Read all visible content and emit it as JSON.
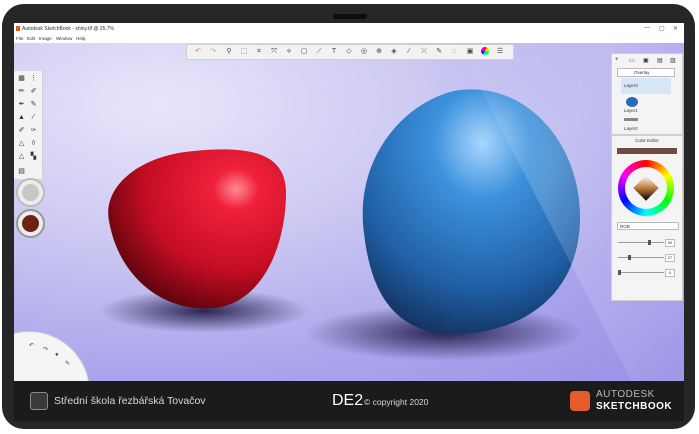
{
  "window": {
    "title": "Autodesk SketchBook - shiny.tif @ 35.7%",
    "controls": [
      "—",
      "▢",
      "✕"
    ]
  },
  "menu": [
    "File",
    "Edit",
    "Image",
    "Window",
    "Help"
  ],
  "toolbar": {
    "icons": [
      "undo-icon",
      "redo-icon",
      "zoom-icon",
      "select-icon",
      "crop-icon",
      "transform-icon",
      "symmetry-icon",
      "ruler-icon",
      "ellipse-icon",
      "text-icon",
      "french-curve-icon",
      "perspective-icon",
      "fill-icon",
      "stroke-icon",
      "distort-icon",
      "lasso-icon",
      "copic-icon",
      "color-wheel-icon",
      "layers-icon"
    ],
    "text_glyph": "T"
  },
  "layers": {
    "blend_mode": "Overlay",
    "items": [
      {
        "name": "Layer3"
      },
      {
        "name": "Layer1"
      },
      {
        "name": "Layer2"
      }
    ]
  },
  "color_editor": {
    "title": "Color Editor",
    "mode": "RGB",
    "values": [
      "90",
      "27",
      "0"
    ]
  },
  "colors": {
    "current_fill": "#6f4a3e",
    "primary_swatch": "#c7c7c7",
    "secondary_swatch": "#6e2216",
    "red_shape": "#d4122a",
    "blue_shape": "#2a7ac4"
  },
  "footer": {
    "school": "Střední škola řezbářská Tovačov",
    "code": "DE2",
    "copyright": "© copyright 2020",
    "brand_line1": "AUTODESK",
    "brand_line2": "SKETCHBOOK"
  }
}
